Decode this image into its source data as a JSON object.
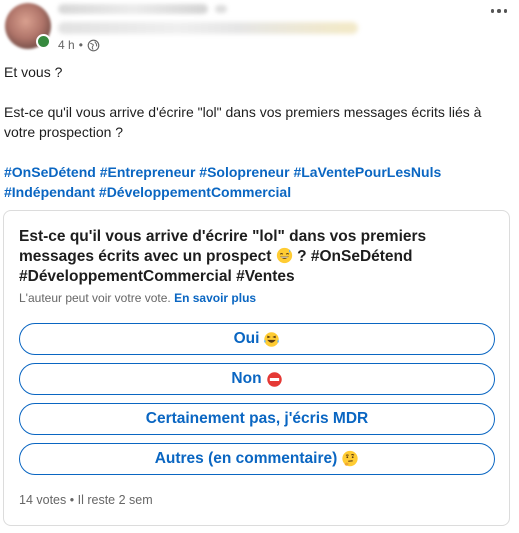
{
  "post": {
    "timestamp": "4 h",
    "visibility_icon": "globe-icon",
    "more_icon": "more-dots-icon",
    "body": {
      "line1": "Et vous ?",
      "line2": "Est-ce qu'il vous arrive d'écrire \"lol\" dans vos premiers messages écrits liés à votre prospection ?"
    },
    "hashtags": [
      "#OnSeDétend",
      "#Entrepreneur",
      "#Solopreneur",
      "#LaVentePourLesNuls",
      "#Indépendant",
      "#DéveloppementCommercial"
    ]
  },
  "poll": {
    "question_part1": "Est-ce qu'il vous arrive d'écrire \"lol\" dans vos premiers messages écrits avec un prospect",
    "question_emoji": "grinning-sweat-emoji",
    "question_part2": "? #OnSeDétend #DéveloppementCommercial #Ventes",
    "note": "L'auteur peut voir votre vote.",
    "learn_more": "En savoir plus",
    "options": [
      {
        "label": "Oui",
        "emoji": "laughing-tears-emoji"
      },
      {
        "label": "Non",
        "emoji": "no-entry-emoji"
      },
      {
        "label": "Certainement pas, j'écris MDR",
        "emoji": ""
      },
      {
        "label": "Autres (en commentaire)",
        "emoji": "thinking-face-emoji"
      }
    ],
    "votes": "14 votes",
    "separator": "•",
    "remaining": "Il reste 2 sem"
  },
  "colors": {
    "link_blue": "#0a66c2",
    "online_green": "#378a3f",
    "muted_text": "#666666",
    "card_border": "#dcdcdc"
  }
}
